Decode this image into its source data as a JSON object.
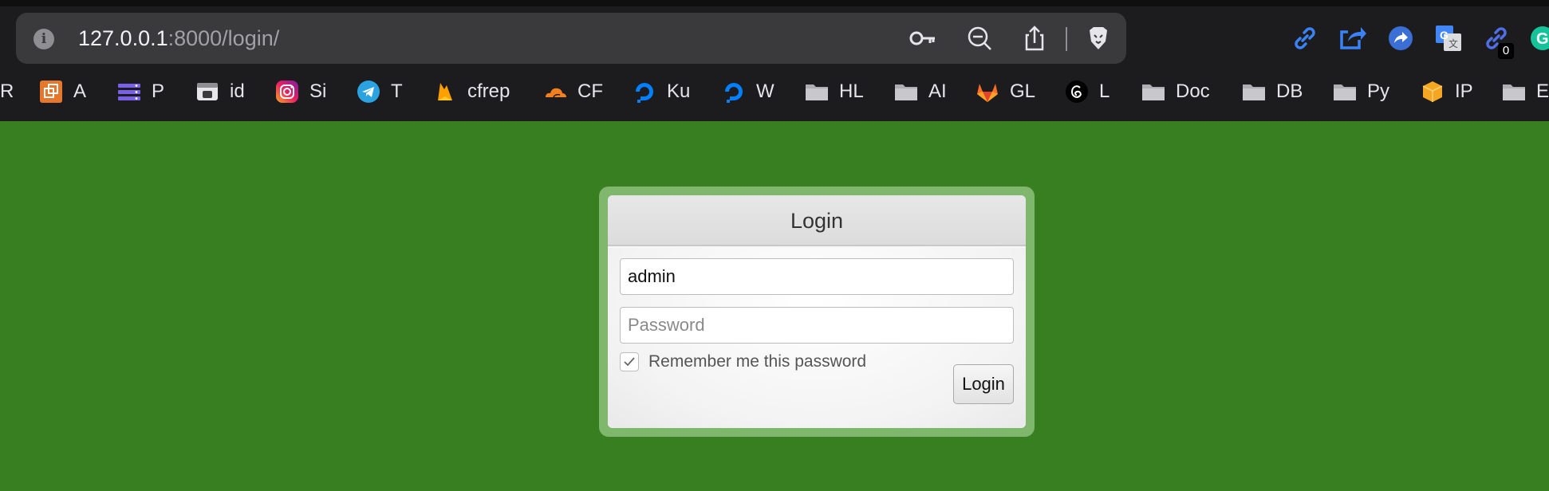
{
  "browser": {
    "url_host": "127.0.0.1",
    "url_rest": ":8000/login/",
    "extension_badge": "0"
  },
  "bookmarks": [
    {
      "label": "R",
      "icon": "none"
    },
    {
      "label": "A",
      "icon": "orange-square-icon"
    },
    {
      "label": "P",
      "icon": "purple-list-icon"
    },
    {
      "label": "id",
      "icon": "browser-window-icon"
    },
    {
      "label": "Si",
      "icon": "instagram-icon"
    },
    {
      "label": "T",
      "icon": "telegram-icon"
    },
    {
      "label": "cfrep",
      "icon": "firebase-icon"
    },
    {
      "label": "CF",
      "icon": "cloudflare-icon"
    },
    {
      "label": "Ku",
      "icon": "digitalocean-icon"
    },
    {
      "label": "W",
      "icon": "digitalocean-icon"
    },
    {
      "label": "HL",
      "icon": "folder-icon"
    },
    {
      "label": "AI",
      "icon": "folder-icon"
    },
    {
      "label": "GL",
      "icon": "gitlab-icon"
    },
    {
      "label": "L",
      "icon": "threads-icon"
    },
    {
      "label": "Doc",
      "icon": "folder-icon"
    },
    {
      "label": "DB",
      "icon": "folder-icon"
    },
    {
      "label": "Py",
      "icon": "folder-icon"
    },
    {
      "label": "IP",
      "icon": "box-icon"
    },
    {
      "label": "E",
      "icon": "folder-icon"
    }
  ],
  "login": {
    "title": "Login",
    "username_value": "admin",
    "password_placeholder": "Password",
    "remember_label": "Remember me this password",
    "remember_checked": true,
    "button_label": "Login"
  },
  "colors": {
    "page_background": "#377f21",
    "panel_border": "#7fb86c",
    "chrome_background": "#1c1c1e"
  }
}
